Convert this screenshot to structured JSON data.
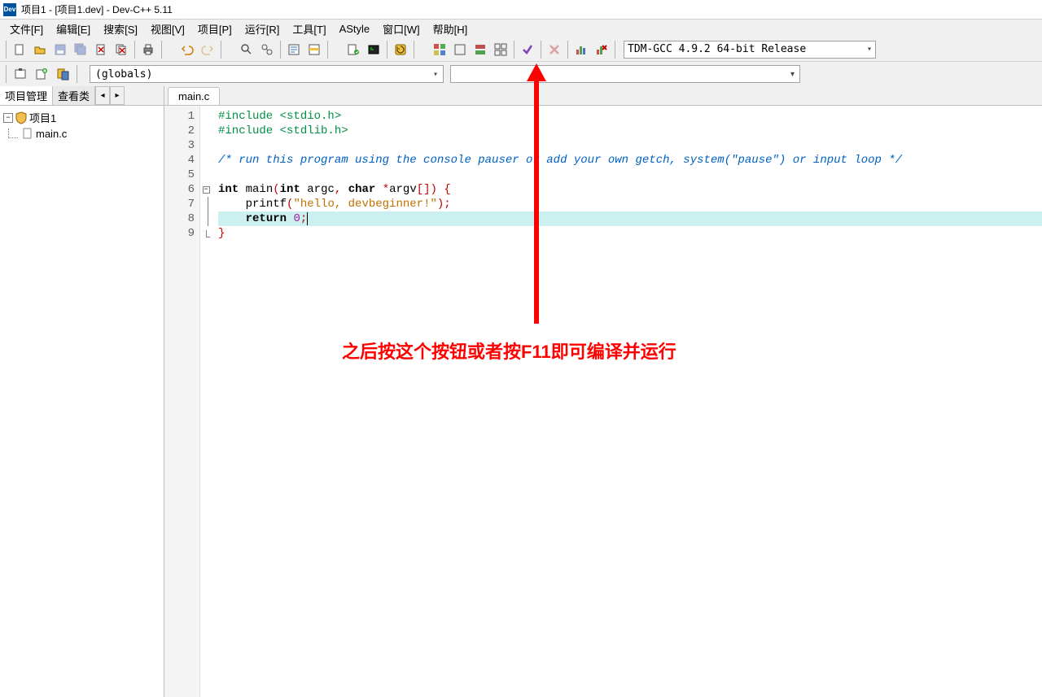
{
  "title": "项目1 - [项目1.dev] - Dev-C++ 5.11",
  "menu": {
    "file": "文件[F]",
    "edit": "编辑[E]",
    "search": "搜索[S]",
    "view": "视图[V]",
    "project": "项目[P]",
    "run": "运行[R]",
    "tools": "工具[T]",
    "astyle": "AStyle",
    "window": "窗口[W]",
    "help": "帮助[H]"
  },
  "compiler_dropdown": "TDM-GCC 4.9.2 64-bit Release",
  "globals_dropdown": "(globals)",
  "sidebar": {
    "tab_project": "项目管理",
    "tab_classes": "查看类",
    "project_root": "项目1",
    "project_file": "main.c"
  },
  "editor": {
    "filename": "main.c",
    "line_numbers": [
      "1",
      "2",
      "3",
      "4",
      "5",
      "6",
      "7",
      "8",
      "9"
    ],
    "code": {
      "l1": "#include <stdio.h>",
      "l2": "#include <stdlib.h>",
      "l4": "/* run this program using the console pauser or add your own getch, system(\"pause\") or input loop */",
      "l6_kw1": "int",
      "l6_fn": "main",
      "l6_kw2": "int",
      "l6_p1": "argc",
      "l6_kw3": "char",
      "l6_p2": "argv",
      "l7_fn": "printf",
      "l7_str": "\"hello, devbeginner!\"",
      "l8_kw": "return",
      "l8_num": "0"
    }
  },
  "annotation": "之后按这个按钮或者按F11即可编译并运行"
}
